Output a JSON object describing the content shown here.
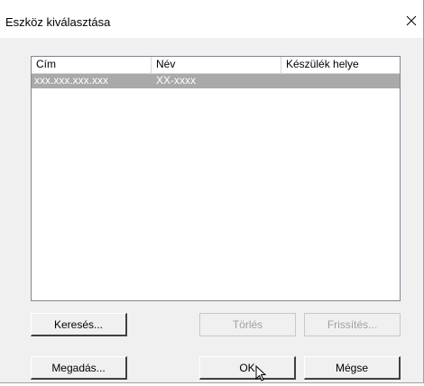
{
  "dialog": {
    "title": "Eszköz kiválasztása",
    "close_icon": "close-icon"
  },
  "device_list": {
    "columns": [
      "Cím",
      "Név",
      "Készülék helye"
    ],
    "rows": [
      {
        "address": "xxx.xxx.xxx.xxx",
        "name": "XX-xxxx",
        "location": "",
        "selected": true
      }
    ]
  },
  "buttons": {
    "search": "Keresés...",
    "delete": "Törlés",
    "refresh": "Frissítés...",
    "specify": "Megadás...",
    "ok": "OK",
    "cancel": "Mégse"
  },
  "colors": {
    "selection": "#a9a9a9",
    "disabled_text": "#a0a0a0"
  }
}
